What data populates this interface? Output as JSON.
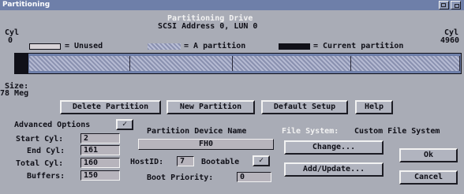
{
  "window": {
    "title": "Partitioning"
  },
  "header": {
    "heading": "Partitioning Drive",
    "scsi": "SCSI Address 0, LUN 0",
    "cyl_left_label": "Cyl",
    "cyl_left_value": "0",
    "cyl_right_label": "Cyl",
    "cyl_right_value": "4960"
  },
  "legend": {
    "unused": "= Unused",
    "a_partition": "= A partition",
    "current": "= Current partition"
  },
  "size": {
    "label": "Size:",
    "value": "78 Meg"
  },
  "buttons": {
    "delete": "Delete Partition",
    "new": "New Partition",
    "default": "Default Setup",
    "help": "Help",
    "change": "Change...",
    "add_update": "Add/Update...",
    "ok": "Ok",
    "cancel": "Cancel"
  },
  "advanced": {
    "label": "Advanced Options",
    "checked": "✓"
  },
  "fields": {
    "start_cyl": {
      "label": "Start Cyl:",
      "value": "2"
    },
    "end_cyl": {
      "label": "End Cyl:",
      "value": "161"
    },
    "total_cyl": {
      "label": "Total Cyl:",
      "value": "160"
    },
    "buffers": {
      "label": "Buffers:",
      "value": "150"
    }
  },
  "device": {
    "label": "Partition Device Name",
    "name": "FH0",
    "host_id_label": "HostID:",
    "host_id": "7",
    "bootable_label": "Bootable",
    "bootable_checked": "✓",
    "boot_priority_label": "Boot Priority:",
    "boot_priority": "0"
  },
  "filesystem": {
    "label": "File System:",
    "value": "Custom File System"
  },
  "colors": {
    "background": "#a9acb6",
    "titlebar": "#6e7fa9",
    "current_partition": "#101018"
  }
}
